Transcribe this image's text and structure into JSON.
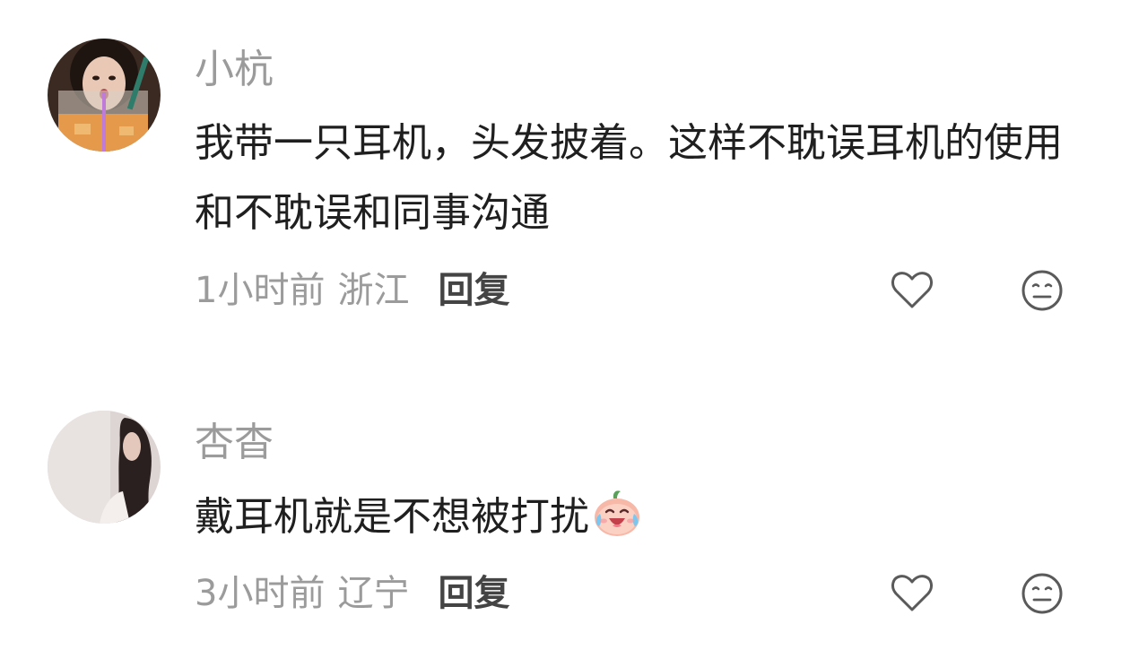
{
  "comments": [
    {
      "username": "小杭",
      "text": "我带一只耳机，头发披着。这样不耽误耳机的使用和不耽误和同事沟通",
      "time": "1小时前",
      "location": "浙江",
      "reply_label": "回复",
      "avatar_icon": "avatar-girl-drinking-icon",
      "like_icon": "heart-outline-icon",
      "dislike_icon": "neutral-face-icon"
    },
    {
      "username": "杏杳",
      "text": "戴耳机就是不想被打扰",
      "emoji_icon": "laughing-tears-emoji-icon",
      "time": "3小时前",
      "location": "辽宁",
      "reply_label": "回复",
      "avatar_icon": "avatar-girl-long-hair-icon",
      "like_icon": "heart-outline-icon",
      "dislike_icon": "neutral-face-icon"
    }
  ],
  "colors": {
    "secondary_text": "#9b9b9b",
    "primary_text": "#1f1f1f",
    "reply_text": "#444444",
    "icon_stroke": "#5a5a5a"
  }
}
